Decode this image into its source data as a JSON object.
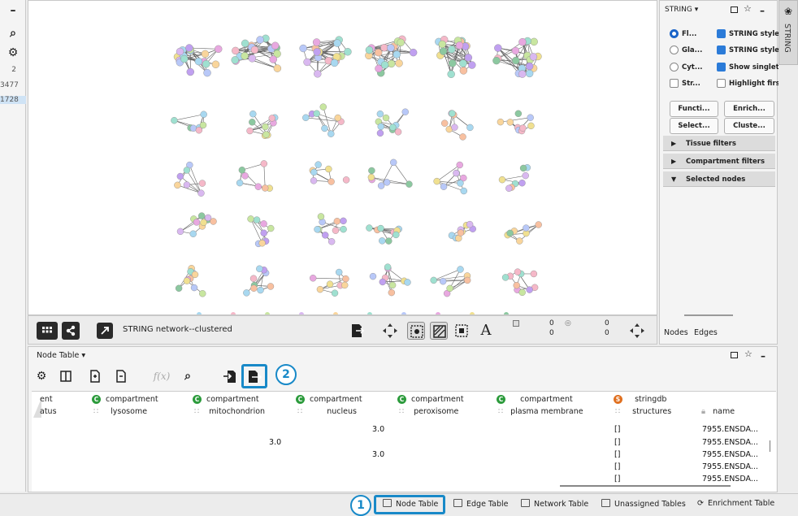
{
  "left_strip": {
    "value_1": "2",
    "value_2": "3477",
    "value_3": "1728"
  },
  "canvas_toolbar": {
    "network_title": "STRING network--clustered",
    "count_selected_nodes": "0",
    "count_total_nodes": "0",
    "count_selected_edges": "0",
    "count_total_edges": "0"
  },
  "right_panel": {
    "dropdown_label": "STRING",
    "options": [
      {
        "label": "Fl...",
        "kind": "radio",
        "checked": true
      },
      {
        "label": "STRING style",
        "kind": "checkbox",
        "checked": true
      },
      {
        "label": "Gla...",
        "kind": "radio",
        "checked": false
      },
      {
        "label": "STRING style",
        "kind": "checkbox",
        "checked": true
      },
      {
        "label": "Cyt...",
        "kind": "radio",
        "checked": false
      },
      {
        "label": "Show singlet",
        "kind": "checkbox",
        "checked": true
      },
      {
        "label": "Str...",
        "kind": "checkbox",
        "checked": false
      },
      {
        "label": "Highlight firs",
        "kind": "checkbox",
        "checked": false
      }
    ],
    "buttons": [
      "Functi...",
      "Enrich...",
      "Select...",
      "Cluste..."
    ],
    "sections": [
      {
        "label": "Tissue filters",
        "expanded": false
      },
      {
        "label": "Compartment filters",
        "expanded": false
      },
      {
        "label": "Selected nodes",
        "expanded": true
      }
    ],
    "tabs": [
      "Nodes",
      "Edges"
    ]
  },
  "vertical_tab": {
    "label": "STRING"
  },
  "table_panel": {
    "title": "Node Table",
    "fx_label": "f(x)",
    "columns": [
      {
        "line1": "ent",
        "line2": "atus",
        "badge": ""
      },
      {
        "line1": "compartment",
        "line2": "lysosome",
        "badge": "C"
      },
      {
        "line1": "compartment",
        "line2": "mitochondrion",
        "badge": "C"
      },
      {
        "line1": "compartment",
        "line2": "nucleus",
        "badge": "C"
      },
      {
        "line1": "compartment",
        "line2": "peroxisome",
        "badge": "C"
      },
      {
        "line1": "compartment",
        "line2": "plasma membrane",
        "badge": "C"
      },
      {
        "line1": "stringdb",
        "line2": "structures",
        "badge": "S"
      },
      {
        "line1": "",
        "line2": "name",
        "badge": ""
      }
    ],
    "rows": [
      {
        "nucleus": "3.0",
        "mito": "",
        "structures": "[]",
        "name": "7955.ENSDA..."
      },
      {
        "nucleus": "",
        "mito": "3.0",
        "structures": "[]",
        "name": "7955.ENSDA..."
      },
      {
        "nucleus": "3.0",
        "mito": "",
        "structures": "[]",
        "name": "7955.ENSDA..."
      },
      {
        "nucleus": "",
        "mito": "",
        "structures": "[]",
        "name": "7955.ENSDA..."
      },
      {
        "nucleus": "",
        "mito": "",
        "structures": "[]",
        "name": "7955.ENSDA..."
      }
    ]
  },
  "callouts": {
    "one": "1",
    "two": "2"
  },
  "bottom_tabs": [
    "Node Table",
    "Edge Table",
    "Network Table",
    "Unassigned Tables",
    "Enrichment Table"
  ],
  "colors": {
    "accent": "#1889c8",
    "checkbox": "#2b7bd8",
    "badge_c": "#2c9b3c",
    "badge_s": "#e07020"
  }
}
